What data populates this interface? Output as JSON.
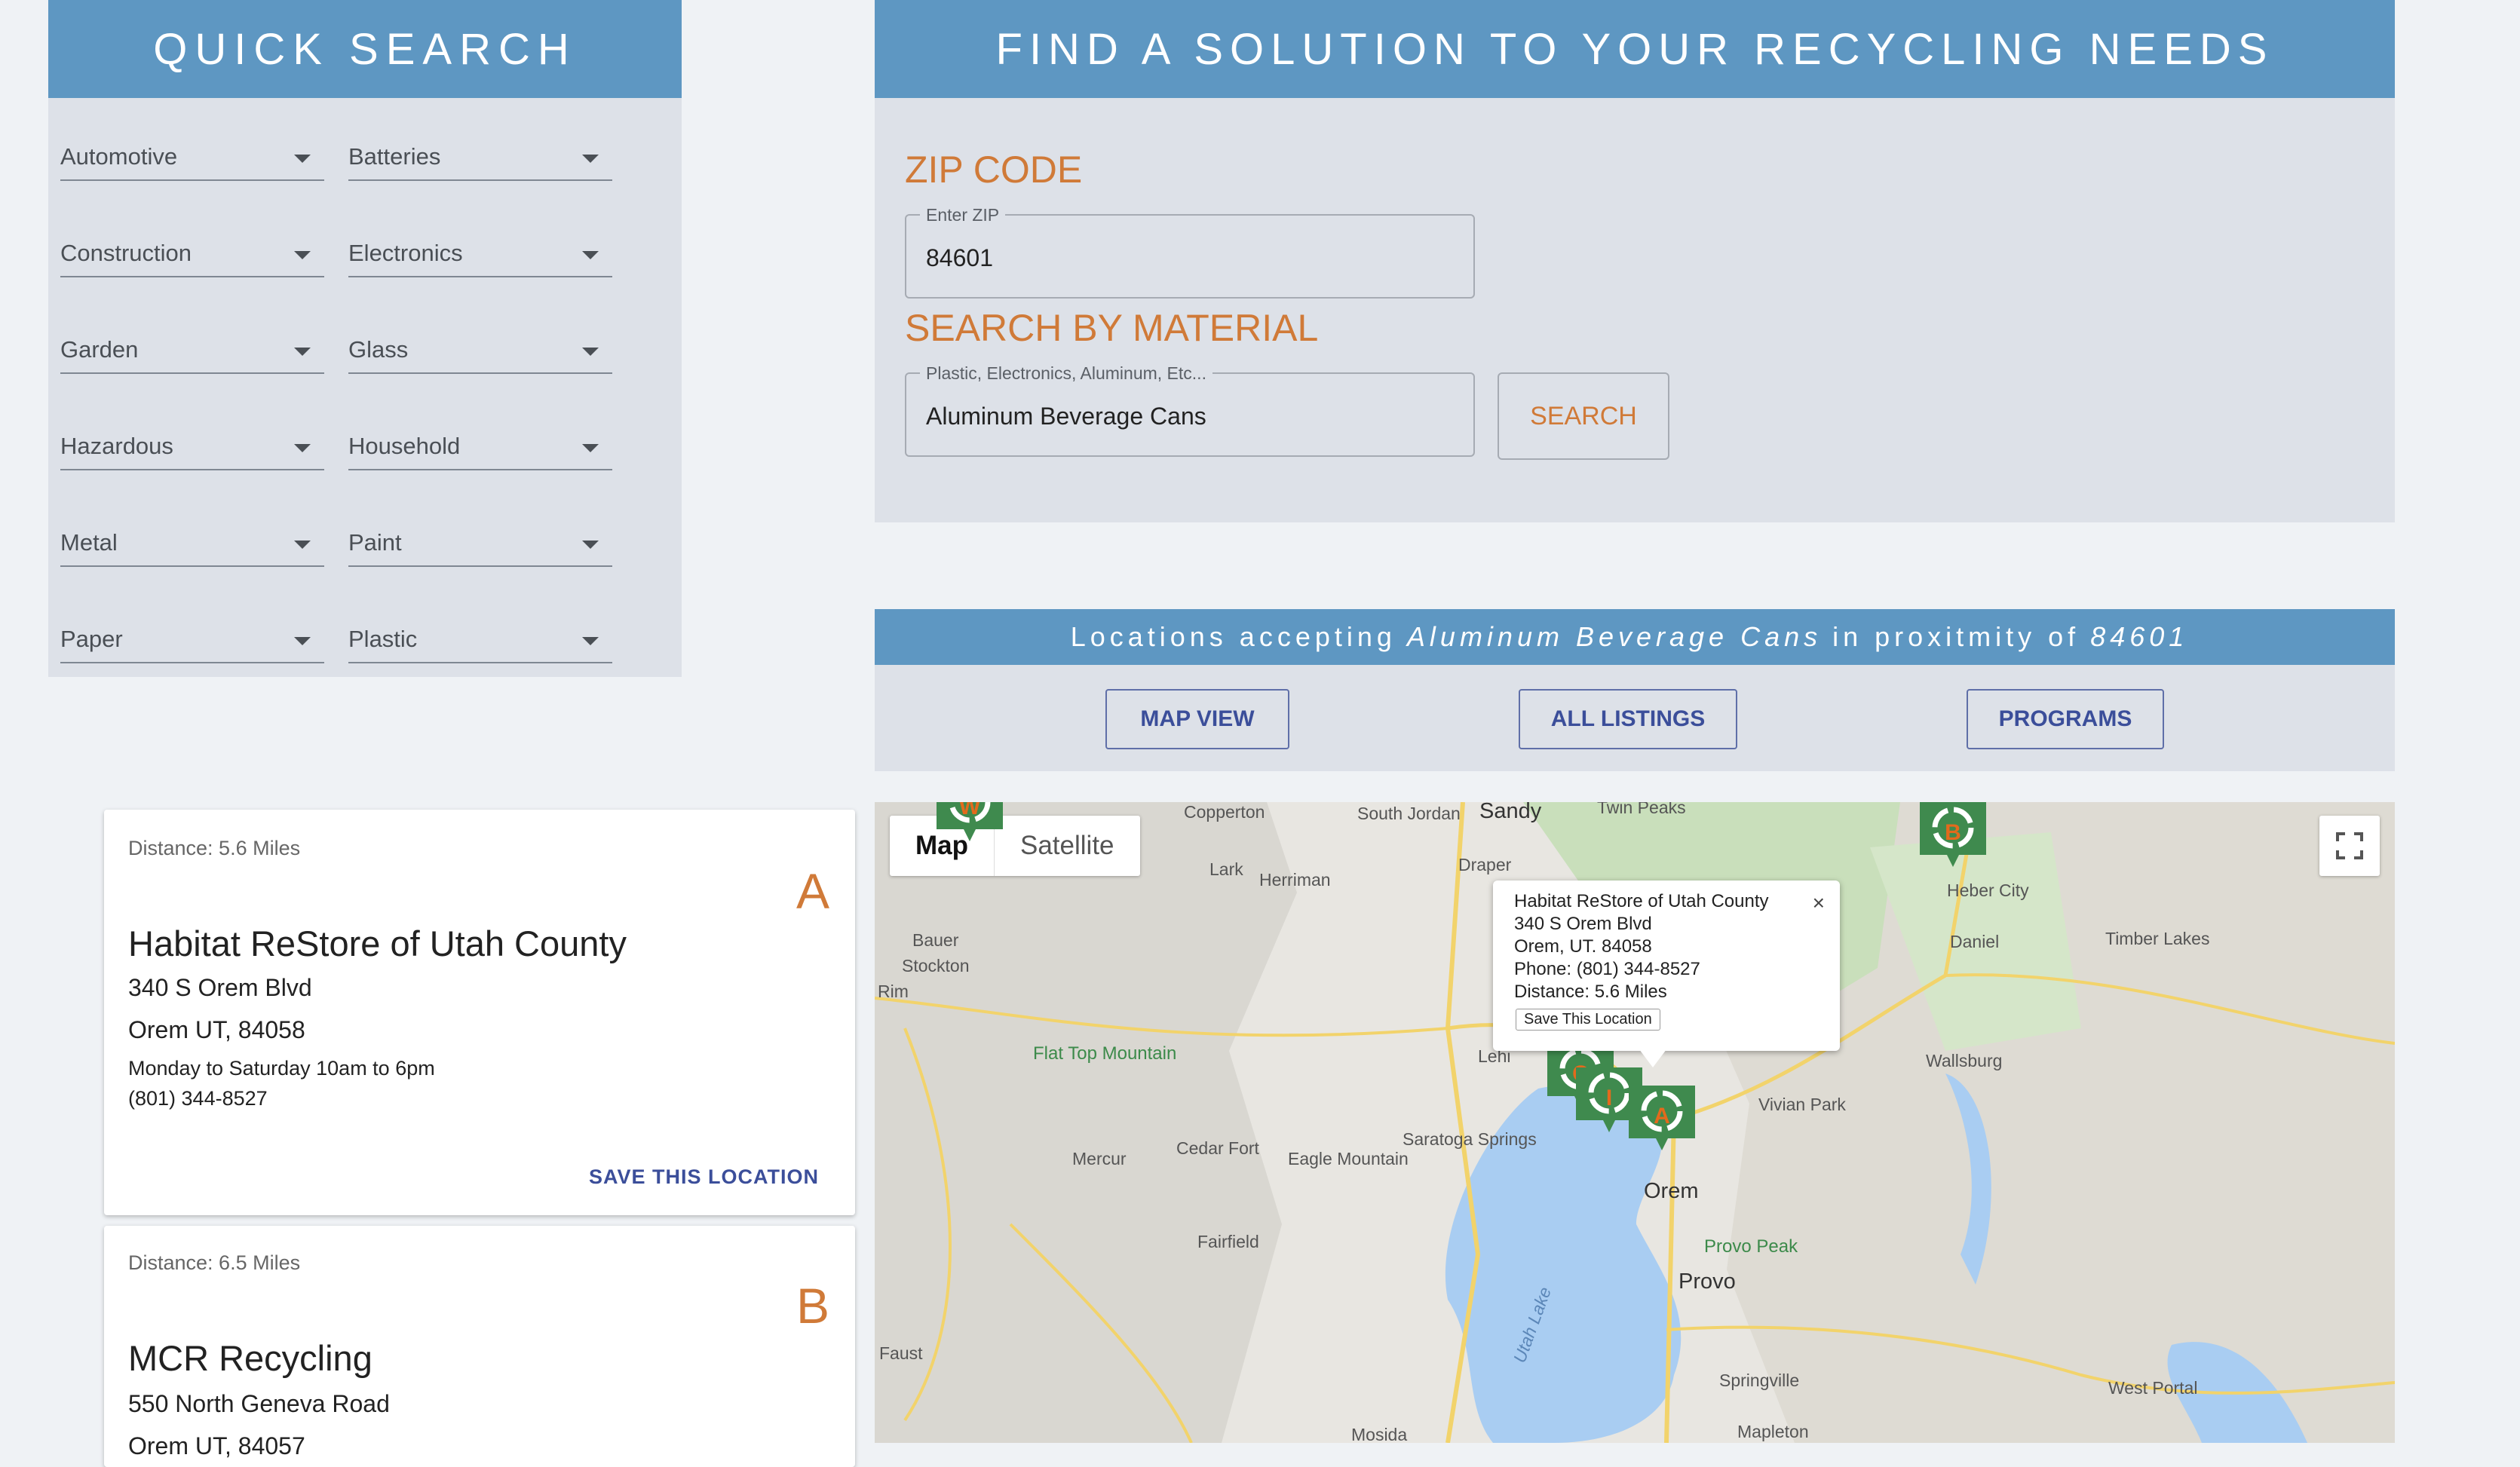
{
  "quick_search": {
    "title": "QUICK SEARCH",
    "categories": [
      "Automotive",
      "Batteries",
      "Construction",
      "Electronics",
      "Garden",
      "Glass",
      "Hazardous",
      "Household",
      "Metal",
      "Paint",
      "Paper",
      "Plastic"
    ]
  },
  "find": {
    "title": "FIND A SOLUTION TO YOUR RECYCLING NEEDS",
    "zip_title": "ZIP CODE",
    "zip_label": "Enter ZIP",
    "zip_value": "84601",
    "material_title": "SEARCH BY MATERIAL",
    "material_label": "Plastic, Electronics, Aluminum, Etc...",
    "material_value": "Aluminum Beverage Cans",
    "search_label": "SEARCH"
  },
  "results": {
    "prefix": "Locations accepting",
    "material": "Aluminum Beverage Cans",
    "middle": "in proxitmity of",
    "zip": "84601",
    "buttons": [
      "MAP VIEW",
      "ALL LISTINGS",
      "PROGRAMS"
    ]
  },
  "listings": [
    {
      "distance": "Distance: 5.6 Miles",
      "letter": "A",
      "name": "Habitat ReStore of Utah County",
      "address1": "340 S Orem Blvd",
      "address2": "Orem UT, 84058",
      "hours": "Monday to Saturday 10am to 6pm",
      "phone": "(801) 344-8527",
      "save": "SAVE THIS LOCATION"
    },
    {
      "distance": "Distance: 6.5 Miles",
      "letter": "B",
      "name": "MCR Recycling",
      "address1": "550 North Geneva Road",
      "address2": "Orem UT, 84057"
    }
  ],
  "map": {
    "map_tab": "Map",
    "satellite_tab": "Satellite",
    "labels": {
      "copperton": "Copperton",
      "south_jordan": "South Jordan",
      "sandy": "Sandy",
      "twin_peaks": "Twin Peaks",
      "lark": "Lark",
      "herriman": "Herriman",
      "draper": "Draper",
      "bauer": "Bauer",
      "stockton": "Stockton",
      "rim": "Rim",
      "heber_city": "Heber City",
      "daniel": "Daniel",
      "timber_lakes": "Timber Lakes",
      "flat_top": "Flat Top Mountain",
      "wallsburg": "Wallsburg",
      "lehi": "Lehi",
      "vivian_park": "Vivian Park",
      "mercur": "Mercur",
      "cedar_fort": "Cedar Fort",
      "eagle_mountain": "Eagle Mountain",
      "saratoga_springs": "Saratoga Springs",
      "orem": "Orem",
      "provo_peak": "Provo Peak",
      "provo": "Provo",
      "fairfield": "Fairfield",
      "faust": "Faust",
      "utah_lake": "Utah Lake",
      "springville": "Springville",
      "west_portal": "West Portal",
      "mosida": "Mosida",
      "mapleton": "Mapleton"
    },
    "info": {
      "name": "Habitat ReStore of Utah County",
      "address": "340 S Orem Blvd",
      "city": "Orem, UT. 84058",
      "phone": "Phone: (801) 344-8527",
      "distance": "Distance: 5.6 Miles",
      "save": "Save This Location",
      "close": "×"
    },
    "marker_letters": [
      "W",
      "B",
      "C",
      "I",
      "A"
    ],
    "colors": {
      "marker": "#3f8a4e",
      "marker_label": "#e36a1c",
      "water": "#a9cdf2",
      "road": "#f2d36b"
    }
  }
}
